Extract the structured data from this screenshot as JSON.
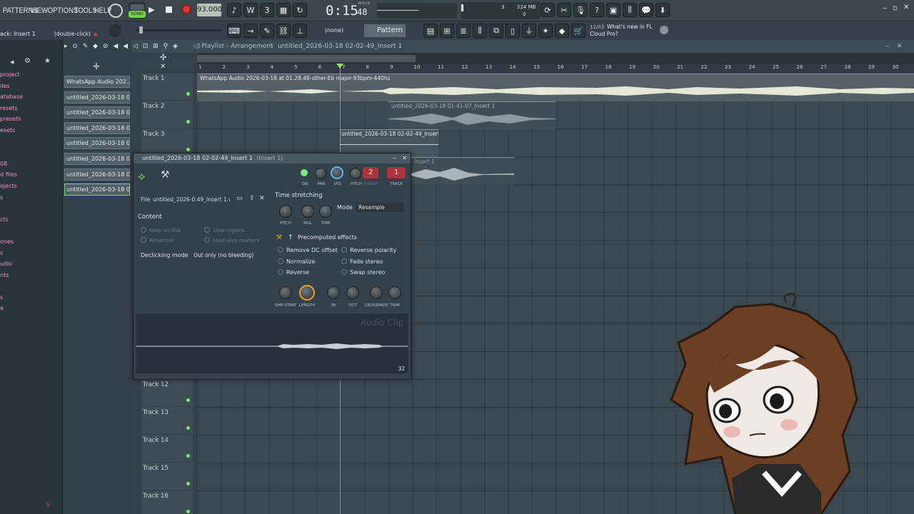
{
  "menu": [
    "PATTERNS",
    "VIEW",
    "OPTIONS",
    "TOOLS",
    "HELP"
  ],
  "transport": {
    "song_badge": "SONG",
    "tempo": "93.000",
    "time": "0:15",
    "time_frac": "48",
    "time_unit": "M:S:CS",
    "cpu_num": "3",
    "mem": "224 MB",
    "mem_num": "0"
  },
  "hint": {
    "left": "ack: Insert 1",
    "right": "(double-click)"
  },
  "toolbar": {
    "pattern_none": "(none)",
    "pattern": "Pattern 1",
    "news_date": "11/03",
    "news_text": "What's new in FL Cloud Pro?"
  },
  "playlist": {
    "title": "Playlist - Arrangement",
    "path": "untitled_2026-03-18 02-02-49_Insert 1",
    "ruler": [
      "1",
      "2",
      "3",
      "4",
      "5",
      "6",
      "7",
      "8",
      "9",
      "10",
      "11",
      "12",
      "13",
      "14",
      "15",
      "16",
      "17",
      "18",
      "19",
      "20",
      "21",
      "22",
      "23",
      "24",
      "25",
      "26",
      "27",
      "28",
      "29",
      "30"
    ]
  },
  "browser_items": [
    "project",
    "iles",
    "atabase",
    "resets",
    "presets",
    "esets",
    "",
    "",
    "08",
    "d files",
    "ojects",
    "s",
    "",
    "cts",
    "",
    "ones",
    "s",
    "udio",
    "nts",
    "",
    "s",
    "a"
  ],
  "channels": [
    "WhatsApp Audio 202...",
    "untitled_2026-03-18 01-...",
    "untitled_2026-03-18 01-...",
    "untitled_2026-03-18 01-...",
    "untitled_2026-03-18 01-...",
    "untitled_2026-03-18 01-...",
    "untitled_2026-03-18 02-...",
    "untitled_2026-03-18 02-..."
  ],
  "tracks": [
    {
      "label": "Track 1"
    },
    {
      "label": "Track 2"
    },
    {
      "label": "Track 3"
    },
    {
      "label": ""
    },
    {
      "label": ""
    },
    {
      "label": ""
    },
    {
      "label": ""
    },
    {
      "label": ""
    },
    {
      "label": ""
    },
    {
      "label": ""
    },
    {
      "label": ""
    },
    {
      "label": "Track 12"
    },
    {
      "label": "Track 13"
    },
    {
      "label": "Track 14"
    },
    {
      "label": "Track 15"
    },
    {
      "label": "Track 16"
    }
  ],
  "clips": {
    "c1": "WhatsApp Audio 2026-03-18 at 01.28.48-other-Eb major-93bpm-440hz",
    "c2": "untitled_2026-03-18 01-41-07_Insert 1",
    "c3": "untitled_2026-03-18 02-02-49_Insert 1",
    "c4": "Insert 1"
  },
  "audio_clip": {
    "title": "untitled_2026-03-18 02-02-49_Insert 1",
    "title_suffix": "(Insert 1)",
    "top_knobs": [
      "ON",
      "PAN",
      "VOL",
      "PITCH",
      "RANGE",
      "TRACK"
    ],
    "range_val": "2",
    "track_val": "1",
    "file_label": "File",
    "file_name": "untitled_2026-0.49_Insert 1.wav",
    "content_label": "Content",
    "keep_on_disk": "Keep on disk",
    "resample": "Resample",
    "load_regions": "Load regions",
    "load_slice_markers": "Load slice markers",
    "declicking_label": "Declicking mode",
    "declicking_value": "Out only (no bleeding)",
    "time_stretching": "Time stretching",
    "mode_label": "Mode",
    "mode_value": "Resample",
    "ts_knobs": [
      "PITCH",
      "MUL",
      "TIME"
    ],
    "precomputed": "Precomputed effects",
    "effects": [
      "Remove DC offset",
      "Normalize",
      "Reverse",
      "Reverse polarity",
      "Fade stereo",
      "Swap stereo"
    ],
    "bottom_knobs": [
      "SMP START",
      "LENGTH",
      "IN",
      "OUT",
      "CROSSFADE",
      "TRIM"
    ],
    "watermark": "Audio Clip",
    "zoom": "32"
  },
  "colors": {
    "accent_green": "#7ce77c",
    "record_red": "#e0343c",
    "clip_wave": "#e4e8d6",
    "knob_orange": "#f0a020"
  }
}
